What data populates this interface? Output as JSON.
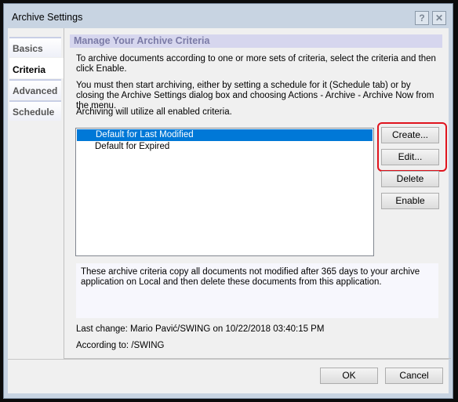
{
  "window": {
    "title": "Archive Settings",
    "help_label": "?",
    "close_label": "✕"
  },
  "tabs": [
    {
      "label": "Basics"
    },
    {
      "label": "Criteria",
      "active": true
    },
    {
      "label": "Advanced"
    },
    {
      "label": "Schedule"
    }
  ],
  "main": {
    "heading": "Manage Your Archive Criteria",
    "para1": "To archive documents according to one or more sets of criteria, select the criteria and then click Enable.",
    "para2": "You must then start archiving, either by setting a schedule for it (Schedule tab) or by closing the Archive Settings dialog box and choosing Actions - Archive - Archive Now from the menu.",
    "para3": "Archiving will utilize all enabled criteria.",
    "criteria": [
      {
        "label": "Default for Last Modified",
        "selected": true
      },
      {
        "label": "Default for Expired",
        "selected": false
      }
    ],
    "buttons": {
      "create": "Create...",
      "edit": "Edit...",
      "delete": "Delete",
      "enable": "Enable"
    },
    "highlight_color": "#e0141e",
    "description": "These archive criteria copy all documents not modified after 365 days to your archive application  on Local and then delete these documents from this application.",
    "last_change": "Last change: Mario Pavić/SWING on 10/22/2018 03:40:15 PM",
    "according_to": "According to: /SWING"
  },
  "footer": {
    "ok": "OK",
    "cancel": "Cancel"
  }
}
